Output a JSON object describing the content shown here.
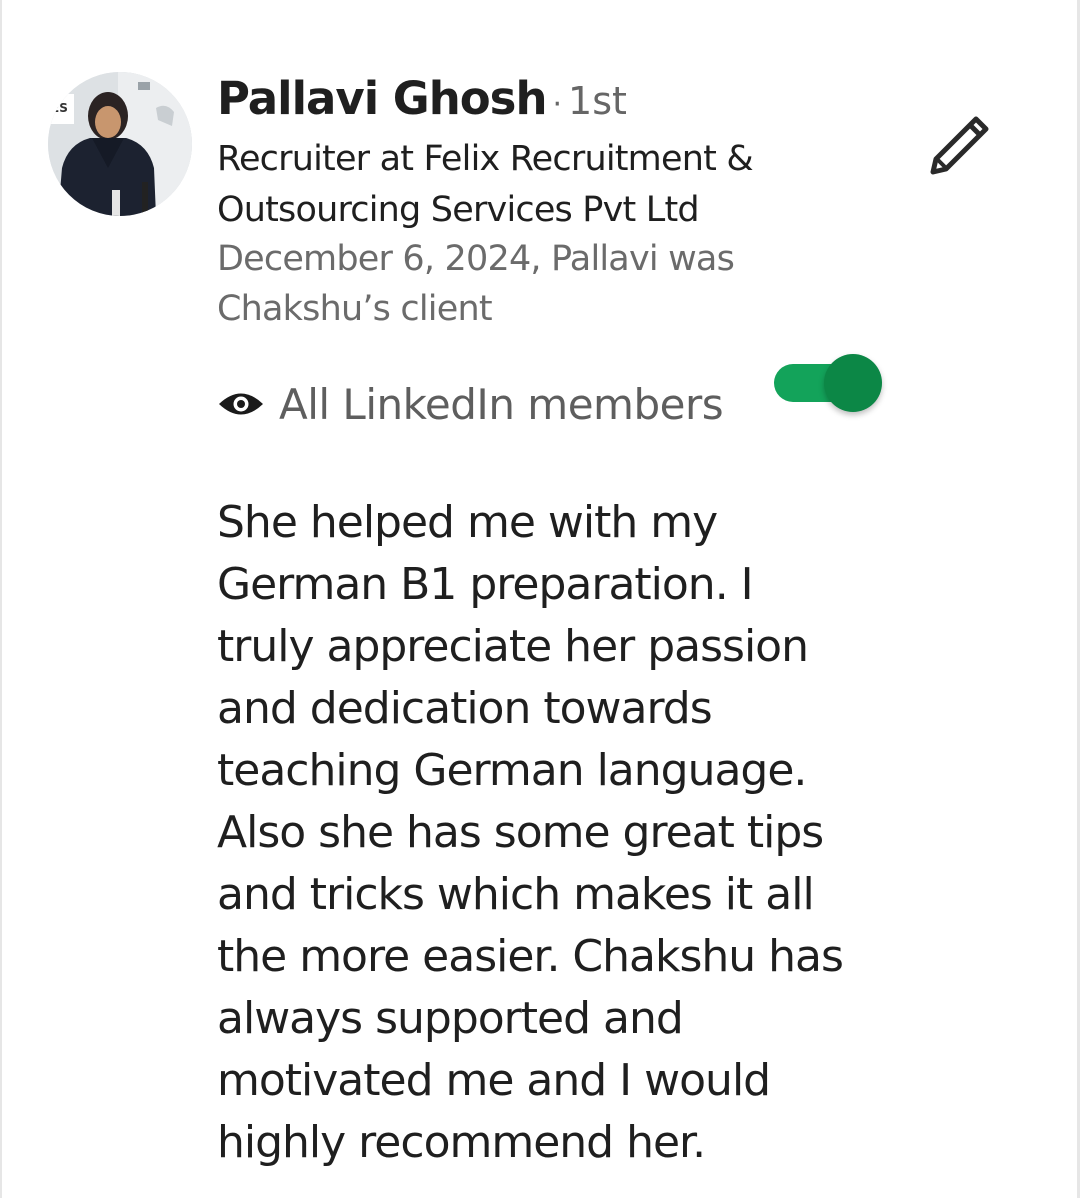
{
  "recommender": {
    "name": "Pallavi Ghosh",
    "connection_degree": "1st",
    "headline": "Recruiter at Felix Recruitment & Outsourcing Services Pvt Ltd",
    "relationship": "December 6, 2024, Pallavi was Chakshu’s client",
    "avatar_icon": "profile-photo"
  },
  "actions": {
    "edit_icon": "pencil-icon"
  },
  "visibility": {
    "icon": "eye-icon",
    "label": "All LinkedIn members",
    "toggle_on": true,
    "toggle_color": "#13a35a"
  },
  "recommendation": {
    "text": "She helped me with my German B1 preparation. I truly appreciate her passion and dedication towards teaching German language. Also she has some great tips and tricks which makes it all the more easier. Chakshu has always supported and motivated me and I would highly recommend her."
  }
}
